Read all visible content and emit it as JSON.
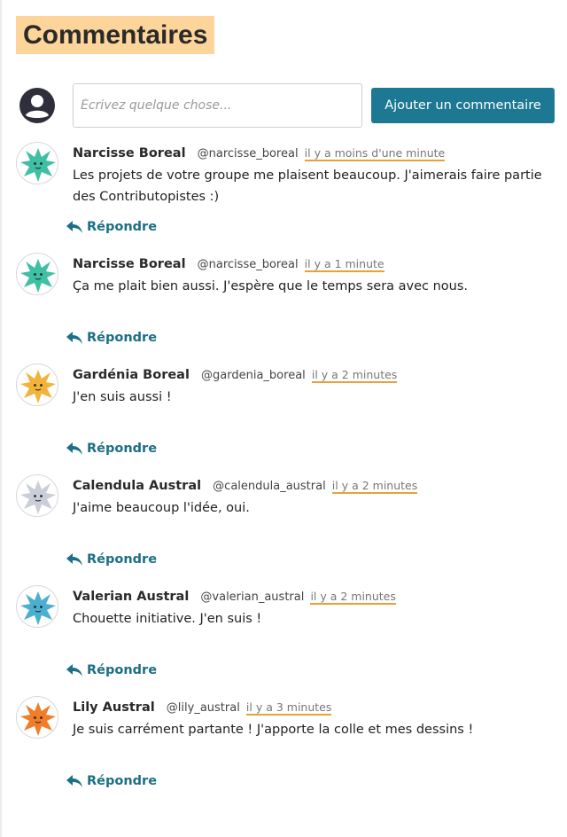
{
  "page": {
    "title": "Commentaires"
  },
  "composer": {
    "placeholder": "Écrivez quelque chose...",
    "value": "",
    "submit_label": "Ajouter un commentaire",
    "accent_color": "#1c7893"
  },
  "colors": {
    "title_highlight": "#fdd49a",
    "time_underline": "#e8a13a",
    "reply_link": "#1c6f86"
  },
  "comments": [
    {
      "author": "Narcisse Boreal",
      "handle": "@narcisse_boreal",
      "time": "il y a moins d'une minute",
      "text": "Les projets de votre groupe me plaisent beaucoup. J'aimerais faire partie des Contributopistes :)",
      "reply_label": "Répondre",
      "avatar_icon": "teal-creature-avatar",
      "avatar_color": "#3fbfa4"
    },
    {
      "author": "Narcisse Boreal",
      "handle": "@narcisse_boreal",
      "time": "il y a 1 minute",
      "text": "Ça me plait bien aussi. J'espère que le temps sera avec nous.",
      "reply_label": "Répondre",
      "avatar_icon": "teal-creature-avatar",
      "avatar_color": "#3fbfa4"
    },
    {
      "author": "Gardénia Boreal",
      "handle": "@gardenia_boreal",
      "time": "il y a 2 minutes",
      "text": "J'en suis aussi !",
      "reply_label": "Répondre",
      "avatar_icon": "yellow-creature-avatar",
      "avatar_color": "#f2b33a"
    },
    {
      "author": "Calendula Austral",
      "handle": "@calendula_austral",
      "time": "il y a 2 minutes",
      "text": "J'aime beaucoup l'idée, oui.",
      "reply_label": "Répondre",
      "avatar_icon": "grey-creature-avatar",
      "avatar_color": "#c9ced8"
    },
    {
      "author": "Valerian Austral",
      "handle": "@valerian_austral",
      "time": "il y a 2 minutes",
      "text": "Chouette initiative. J'en suis !",
      "reply_label": "Répondre",
      "avatar_icon": "blue-creature-avatar",
      "avatar_color": "#4bb0cf"
    },
    {
      "author": "Lily Austral",
      "handle": "@lily_austral",
      "time": "il y a 3 minutes",
      "text": "Je suis carrément partante ! J'apporte la colle et mes dessins !",
      "reply_label": "Répondre",
      "avatar_icon": "orange-creature-avatar",
      "avatar_color": "#f07d2a"
    }
  ]
}
